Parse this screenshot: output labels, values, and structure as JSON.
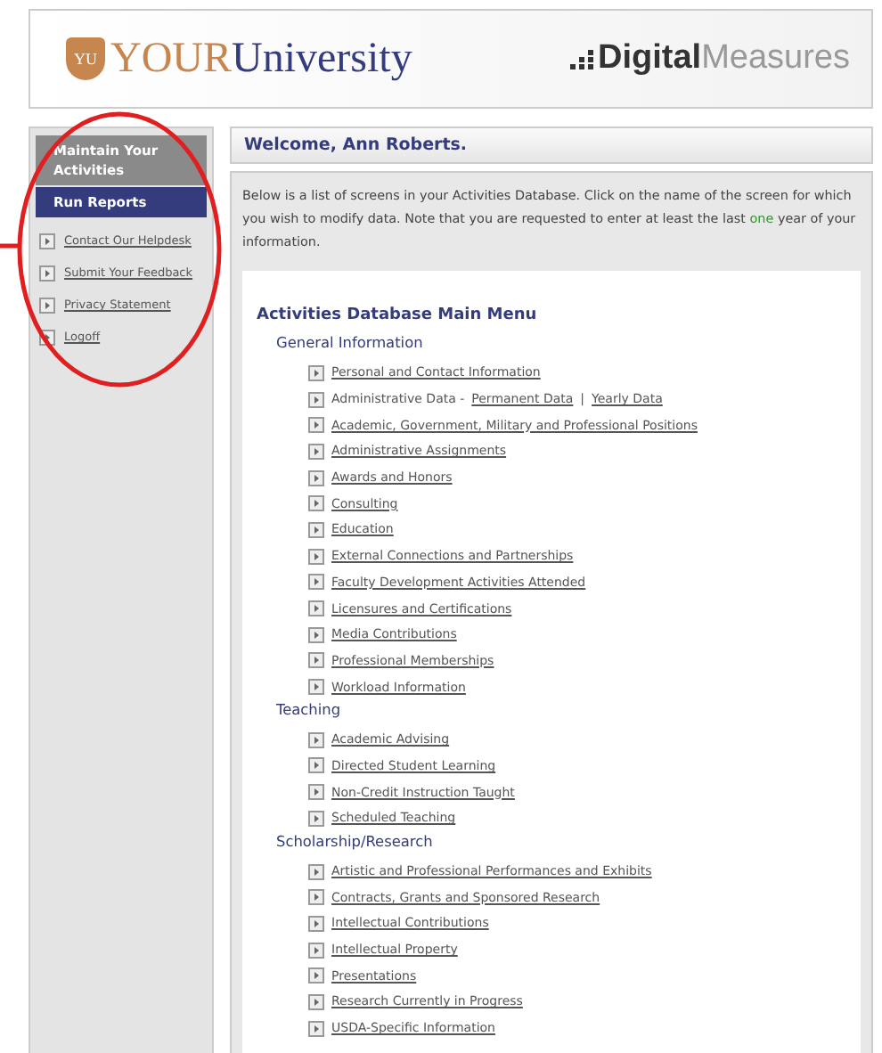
{
  "header": {
    "crest_initials": "YU",
    "university": [
      "YOUR",
      "University"
    ],
    "vendor": [
      "Digital",
      "Measures"
    ]
  },
  "sidebar": {
    "tabs": [
      {
        "label": "Maintain Your Activities",
        "selected": true
      },
      {
        "label": "Run Reports",
        "selected": false
      }
    ],
    "links": [
      "Contact Our Helpdesk",
      "Submit Your Feedback",
      "Privacy Statement",
      "Logoff"
    ]
  },
  "welcome": "Welcome, Ann Roberts.",
  "intro": {
    "text": "Below is a list of screens in your Activities Database. Click on the name of the screen for which you wish to modify data. Note that you are requested to enter at least the last",
    "highlight": "one",
    "tail": "year of your information."
  },
  "menu": {
    "title": "Activities Database Main Menu",
    "sections": [
      {
        "title": "General Information",
        "items": [
          {
            "kind": "link",
            "label": "Personal and Contact Information"
          },
          {
            "kind": "split",
            "label": "Administrative Data -",
            "links": [
              "Permanent Data",
              "Yearly Data"
            ],
            "separator": "|"
          },
          {
            "kind": "link",
            "label": "Academic, Government, Military and Professional Positions"
          },
          {
            "kind": "link",
            "label": "Administrative Assignments"
          },
          {
            "kind": "link",
            "label": "Awards and Honors"
          },
          {
            "kind": "link",
            "label": "Consulting"
          },
          {
            "kind": "link",
            "label": "Education"
          },
          {
            "kind": "link",
            "label": "External Connections and Partnerships"
          },
          {
            "kind": "link",
            "label": "Faculty Development Activities Attended"
          },
          {
            "kind": "link",
            "label": "Licensures and Certifications"
          },
          {
            "kind": "link",
            "label": "Media Contributions"
          },
          {
            "kind": "link",
            "label": "Professional Memberships"
          },
          {
            "kind": "link",
            "label": "Workload Information"
          }
        ]
      },
      {
        "title": "Teaching",
        "items": [
          {
            "kind": "link",
            "label": "Academic Advising"
          },
          {
            "kind": "link",
            "label": "Directed Student Learning"
          },
          {
            "kind": "link",
            "label": "Non-Credit Instruction Taught"
          },
          {
            "kind": "link",
            "label": "Scheduled Teaching"
          }
        ]
      },
      {
        "title": "Scholarship/Research",
        "items": [
          {
            "kind": "link",
            "label": "Artistic and Professional Performances and Exhibits"
          },
          {
            "kind": "link",
            "label": "Contracts, Grants and Sponsored Research"
          },
          {
            "kind": "link",
            "label": "Intellectual Contributions"
          },
          {
            "kind": "link",
            "label": "Intellectual Property"
          },
          {
            "kind": "link",
            "label": "Presentations"
          },
          {
            "kind": "link",
            "label": "Research Currently in Progress"
          },
          {
            "kind": "link",
            "label": "USDA-Specific Information"
          }
        ]
      }
    ]
  }
}
